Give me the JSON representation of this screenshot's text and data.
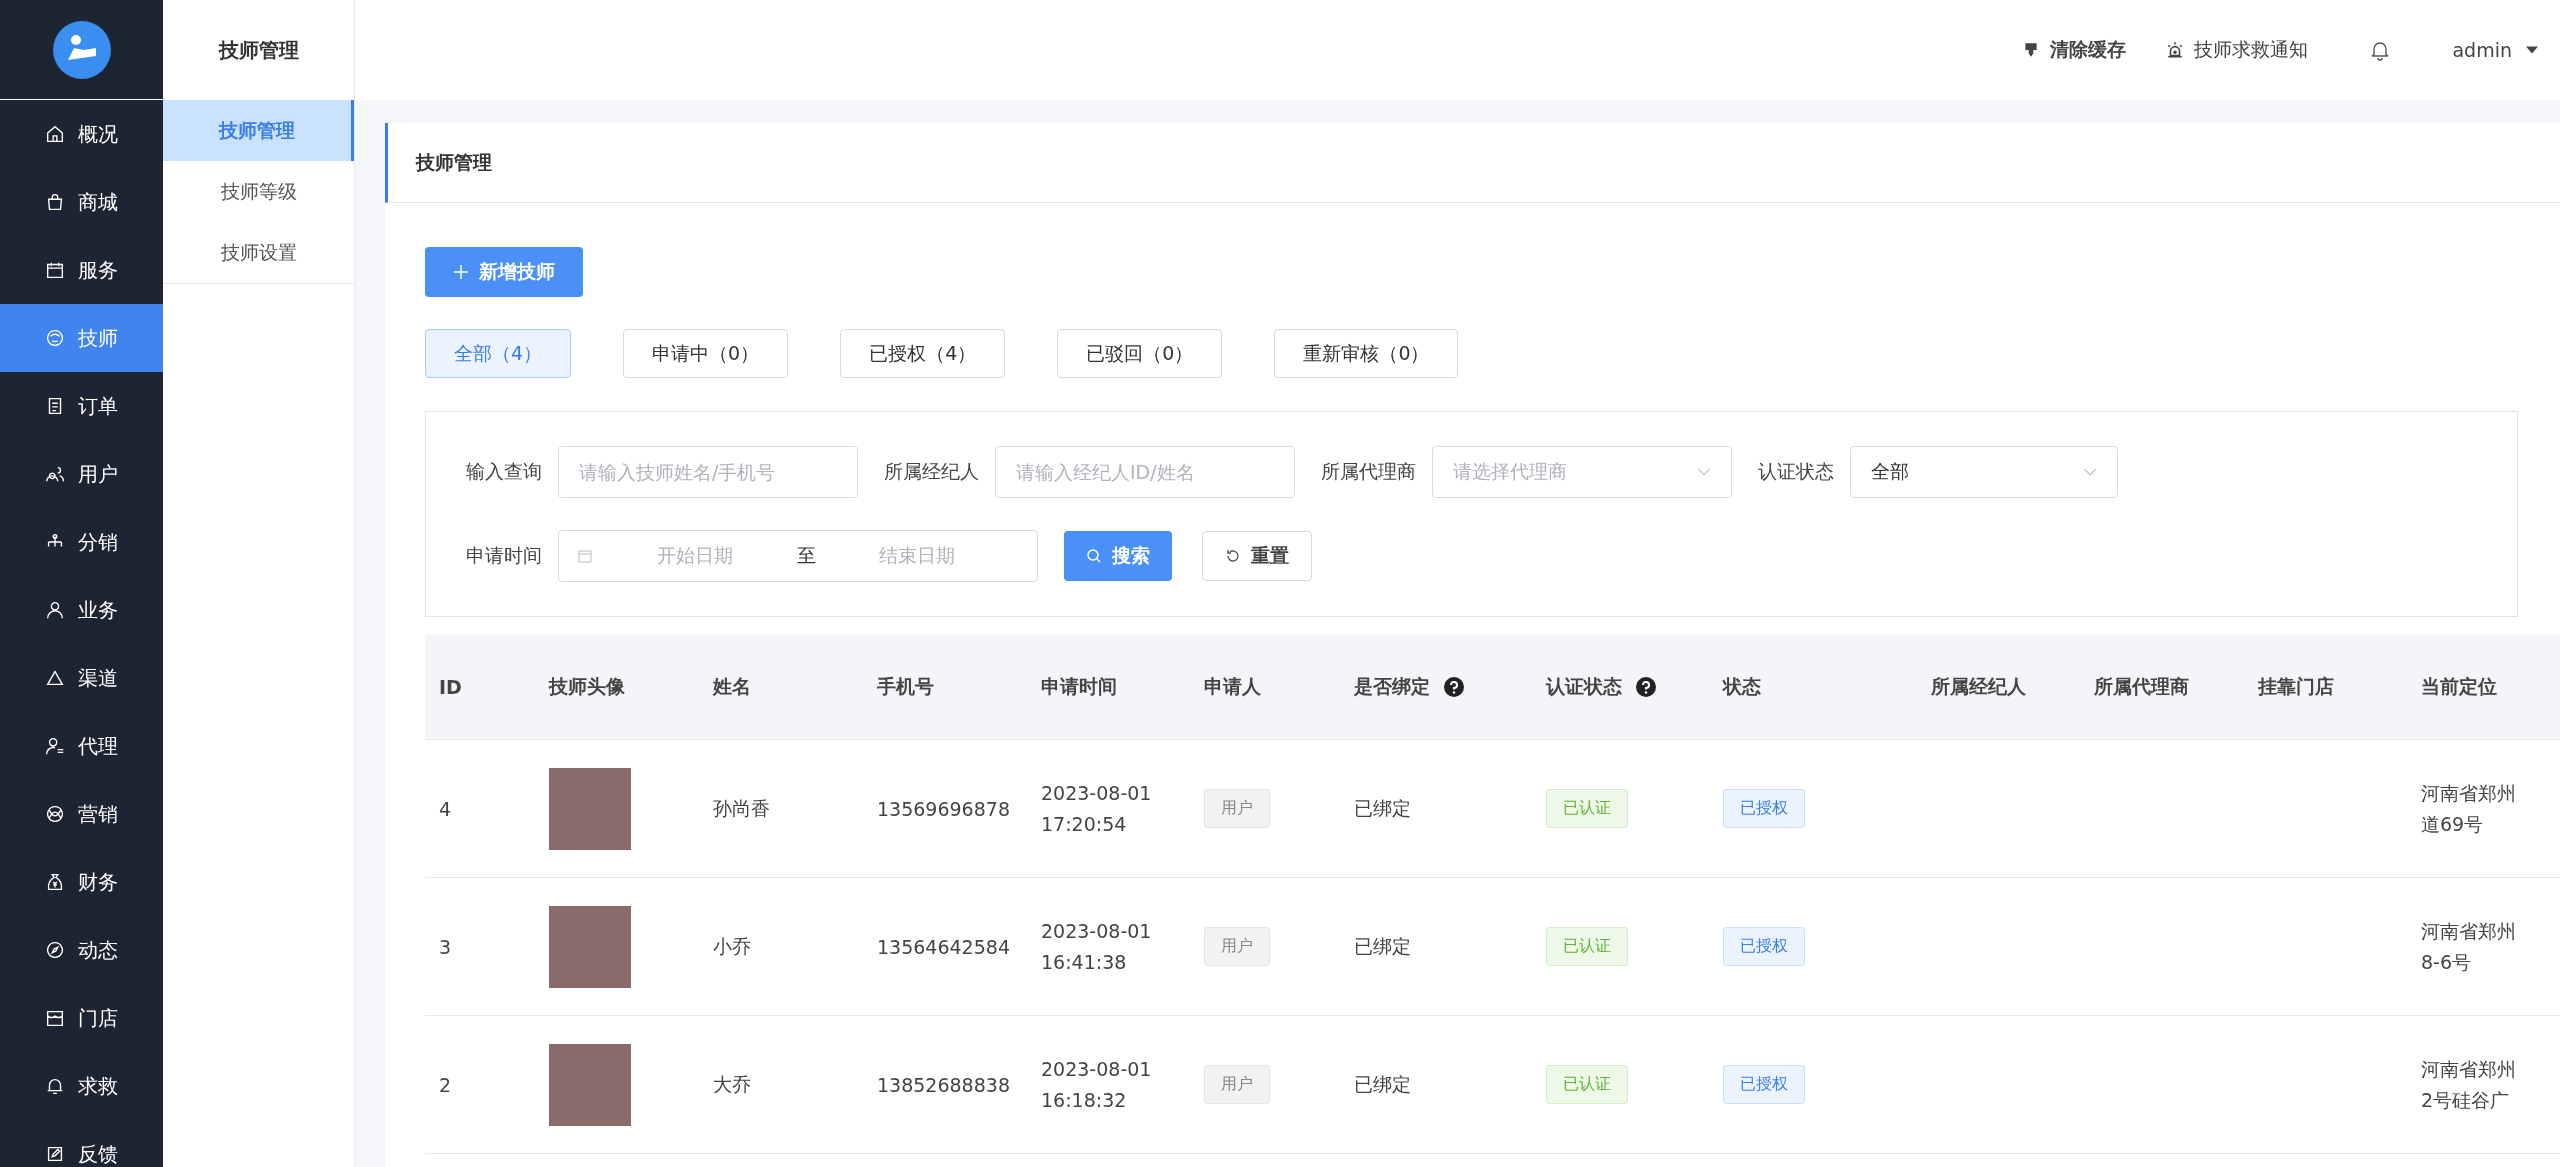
{
  "sidebar": {
    "items": [
      {
        "label": "概况",
        "selected": false
      },
      {
        "label": "商城",
        "selected": false
      },
      {
        "label": "服务",
        "selected": false
      },
      {
        "label": "技师",
        "selected": true
      },
      {
        "label": "订单",
        "selected": false
      },
      {
        "label": "用户",
        "selected": false
      },
      {
        "label": "分销",
        "selected": false
      },
      {
        "label": "业务",
        "selected": false
      },
      {
        "label": "渠道",
        "selected": false
      },
      {
        "label": "代理",
        "selected": false
      },
      {
        "label": "营销",
        "selected": false
      },
      {
        "label": "财务",
        "selected": false
      },
      {
        "label": "动态",
        "selected": false
      },
      {
        "label": "门店",
        "selected": false
      },
      {
        "label": "求救",
        "selected": false
      },
      {
        "label": "反馈",
        "selected": false
      }
    ]
  },
  "submenu": {
    "title": "技师管理",
    "items": [
      {
        "label": "技师管理",
        "selected": true
      },
      {
        "label": "技师等级",
        "selected": false
      },
      {
        "label": "技师设置",
        "selected": false
      }
    ]
  },
  "header": {
    "clear_cache": "清除缓存",
    "sos_notice": "技师求救通知",
    "user": "admin"
  },
  "page_title": "技师管理",
  "add_button": "新增技师",
  "tabs": [
    {
      "label": "全部（4）",
      "selected": true
    },
    {
      "label": "申请中（0）",
      "selected": false
    },
    {
      "label": "已授权（4）",
      "selected": false
    },
    {
      "label": "已驳回（0）",
      "selected": false
    },
    {
      "label": "重新审核（0）",
      "selected": false
    }
  ],
  "filters": {
    "query_label": "输入查询",
    "query_placeholder": "请输入技师姓名/手机号",
    "broker_label": "所属经纪人",
    "broker_placeholder": "请输入经纪人ID/姓名",
    "agent_label": "所属代理商",
    "agent_placeholder": "请选择代理商",
    "auth_label": "认证状态",
    "auth_value": "全部",
    "time_label": "申请时间",
    "start_placeholder": "开始日期",
    "range_separator": "至",
    "end_placeholder": "结束日期",
    "search_button": "搜索",
    "reset_button": "重置"
  },
  "table": {
    "columns": [
      {
        "label": "ID",
        "help": false
      },
      {
        "label": "技师头像",
        "help": false
      },
      {
        "label": "姓名",
        "help": false
      },
      {
        "label": "手机号",
        "help": false
      },
      {
        "label": "申请时间",
        "help": false
      },
      {
        "label": "申请人",
        "help": false
      },
      {
        "label": "是否绑定",
        "help": true
      },
      {
        "label": "认证状态",
        "help": true
      },
      {
        "label": "状态",
        "help": false
      },
      {
        "label": "所属经纪人",
        "help": false
      },
      {
        "label": "所属代理商",
        "help": false
      },
      {
        "label": "挂靠门店",
        "help": false
      },
      {
        "label": "当前定位",
        "help": false
      }
    ],
    "rows": [
      {
        "id": "4",
        "name": "孙尚香",
        "phone": "13569696878",
        "apply_time": "2023-08-01 17:20:54",
        "applicant": "用户",
        "bound": "已绑定",
        "auth": "已认证",
        "status": "已授权",
        "location": "河南省郑州道69号"
      },
      {
        "id": "3",
        "name": "小乔",
        "phone": "13564642584",
        "apply_time": "2023-08-01 16:41:38",
        "applicant": "用户",
        "bound": "已绑定",
        "auth": "已认证",
        "status": "已授权",
        "location": "河南省郑州8-6号"
      },
      {
        "id": "2",
        "name": "大乔",
        "phone": "13852688838",
        "apply_time": "2023-08-01 16:18:32",
        "applicant": "用户",
        "bound": "已绑定",
        "auth": "已认证",
        "status": "已授权",
        "location": "河南省郑州2号硅谷广"
      }
    ]
  }
}
